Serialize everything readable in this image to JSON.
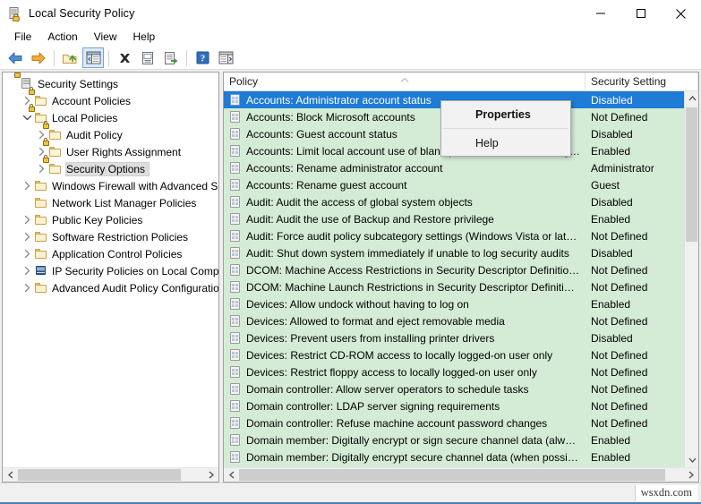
{
  "window": {
    "title": "Local Security Policy",
    "icon": "security-policy-icon",
    "controls": {
      "minimize": "Minimize",
      "maximize": "Maximize",
      "close": "Close"
    }
  },
  "menubar": {
    "items": [
      {
        "label": "File"
      },
      {
        "label": "Action"
      },
      {
        "label": "View"
      },
      {
        "label": "Help"
      }
    ]
  },
  "toolbar": {
    "buttons": [
      {
        "name": "back-icon",
        "title": "Back"
      },
      {
        "name": "forward-icon",
        "title": "Forward"
      },
      {
        "name": "up-folder-icon",
        "title": "Up One Level"
      },
      {
        "name": "show-hide-console-tree-icon",
        "title": "Show/Hide Console Tree",
        "pressed": true
      },
      {
        "name": "delete-icon",
        "title": "Delete"
      },
      {
        "name": "properties-icon",
        "title": "Properties"
      },
      {
        "name": "export-list-icon",
        "title": "Export List"
      },
      {
        "name": "help-icon",
        "title": "Help"
      },
      {
        "name": "show-hide-action-pane-icon",
        "title": "Show/Hide Action Pane"
      }
    ]
  },
  "tree": {
    "nodes": [
      {
        "label": "Security Settings",
        "indent": 0,
        "icon": "security-settings-icon",
        "twist": "none",
        "selected": false
      },
      {
        "label": "Account Policies",
        "indent": 1,
        "icon": "folder-lock-icon",
        "twist": "collapsed",
        "selected": false
      },
      {
        "label": "Local Policies",
        "indent": 1,
        "icon": "folder-lock-icon",
        "twist": "expanded",
        "selected": false
      },
      {
        "label": "Audit Policy",
        "indent": 2,
        "icon": "folder-lock-icon",
        "twist": "collapsed",
        "selected": false
      },
      {
        "label": "User Rights Assignment",
        "indent": 2,
        "icon": "folder-lock-icon",
        "twist": "collapsed",
        "selected": false
      },
      {
        "label": "Security Options",
        "indent": 2,
        "icon": "folder-lock-icon",
        "twist": "collapsed",
        "selected": true
      },
      {
        "label": "Windows Firewall with Advanced Secu",
        "indent": 1,
        "icon": "folder-icon",
        "twist": "collapsed",
        "selected": false
      },
      {
        "label": "Network List Manager Policies",
        "indent": 1,
        "icon": "folder-icon",
        "twist": "none",
        "selected": false
      },
      {
        "label": "Public Key Policies",
        "indent": 1,
        "icon": "folder-icon",
        "twist": "collapsed",
        "selected": false
      },
      {
        "label": "Software Restriction Policies",
        "indent": 1,
        "icon": "folder-icon",
        "twist": "collapsed",
        "selected": false
      },
      {
        "label": "Application Control Policies",
        "indent": 1,
        "icon": "folder-icon",
        "twist": "collapsed",
        "selected": false
      },
      {
        "label": "IP Security Policies on Local Computer",
        "indent": 1,
        "icon": "ip-security-icon",
        "twist": "collapsed",
        "selected": false
      },
      {
        "label": "Advanced Audit Policy Configuration",
        "indent": 1,
        "icon": "folder-icon",
        "twist": "collapsed",
        "selected": false
      }
    ]
  },
  "list": {
    "columns": [
      {
        "label": "Policy",
        "sort": "ascending"
      },
      {
        "label": "Security Setting",
        "sort": "none"
      }
    ],
    "rows": [
      {
        "policy": "Accounts: Administrator account status",
        "setting": "Disabled",
        "selected": true
      },
      {
        "policy": "Accounts: Block Microsoft accounts",
        "setting": "Not Defined",
        "selected": false
      },
      {
        "policy": "Accounts: Guest account status",
        "setting": "Disabled",
        "selected": false
      },
      {
        "policy": "Accounts: Limit local account use of blank passwords to console logo...",
        "setting": "Enabled",
        "selected": false
      },
      {
        "policy": "Accounts: Rename administrator account",
        "setting": "Administrator",
        "selected": false
      },
      {
        "policy": "Accounts: Rename guest account",
        "setting": "Guest",
        "selected": false
      },
      {
        "policy": "Audit: Audit the access of global system objects",
        "setting": "Disabled",
        "selected": false
      },
      {
        "policy": "Audit: Audit the use of Backup and Restore privilege",
        "setting": "Enabled",
        "selected": false
      },
      {
        "policy": "Audit: Force audit policy subcategory settings (Windows Vista or later)...",
        "setting": "Not Defined",
        "selected": false
      },
      {
        "policy": "Audit: Shut down system immediately if unable to log security audits",
        "setting": "Disabled",
        "selected": false
      },
      {
        "policy": "DCOM: Machine Access Restrictions in Security Descriptor Definition L...",
        "setting": "Not Defined",
        "selected": false
      },
      {
        "policy": "DCOM: Machine Launch Restrictions in Security Descriptor Definition ...",
        "setting": "Not Defined",
        "selected": false
      },
      {
        "policy": "Devices: Allow undock without having to log on",
        "setting": "Enabled",
        "selected": false
      },
      {
        "policy": "Devices: Allowed to format and eject removable media",
        "setting": "Not Defined",
        "selected": false
      },
      {
        "policy": "Devices: Prevent users from installing printer drivers",
        "setting": "Disabled",
        "selected": false
      },
      {
        "policy": "Devices: Restrict CD-ROM access to locally logged-on user only",
        "setting": "Not Defined",
        "selected": false
      },
      {
        "policy": "Devices: Restrict floppy access to locally logged-on user only",
        "setting": "Not Defined",
        "selected": false
      },
      {
        "policy": "Domain controller: Allow server operators to schedule tasks",
        "setting": "Not Defined",
        "selected": false
      },
      {
        "policy": "Domain controller: LDAP server signing requirements",
        "setting": "Not Defined",
        "selected": false
      },
      {
        "policy": "Domain controller: Refuse machine account password changes",
        "setting": "Not Defined",
        "selected": false
      },
      {
        "policy": "Domain member: Digitally encrypt or sign secure channel data (always)",
        "setting": "Enabled",
        "selected": false
      },
      {
        "policy": "Domain member: Digitally encrypt secure channel data (when possible)",
        "setting": "Enabled",
        "selected": false
      }
    ]
  },
  "context_menu": {
    "items": [
      {
        "label": "Properties",
        "bold": true
      },
      {
        "label": "Help",
        "bold": false
      }
    ]
  },
  "statusbar": {
    "watermark": "wsxdn.com"
  },
  "colors": {
    "selection_blue": "#1e7bd6",
    "list_background": "#d4ecd5",
    "accent_bottom": "#4a7fb5",
    "tree_selection": "#dedede"
  }
}
